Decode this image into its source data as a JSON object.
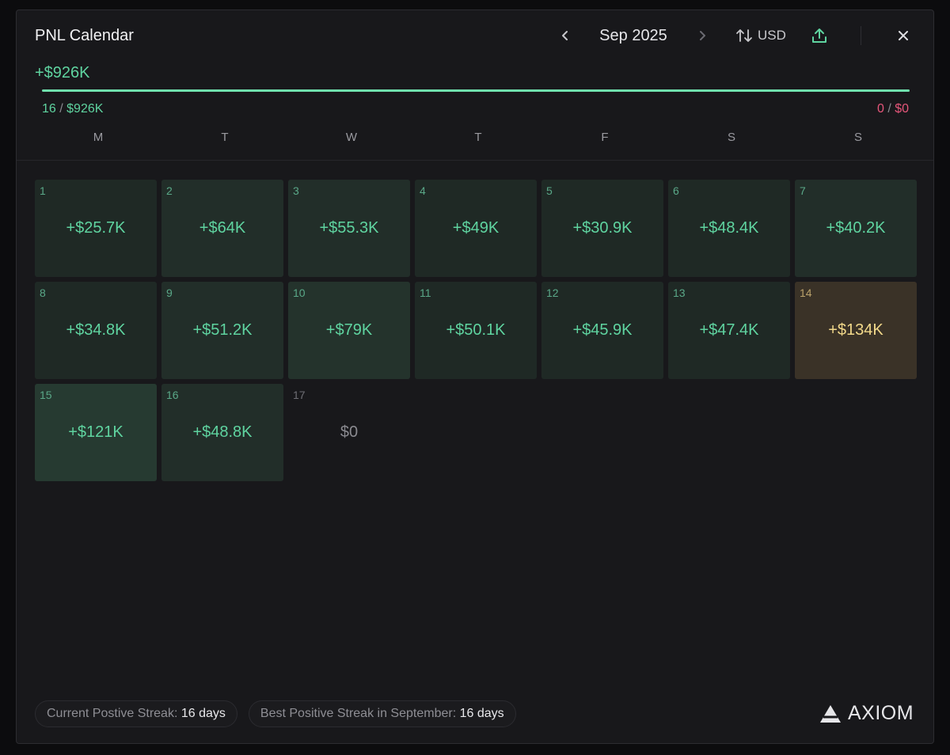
{
  "header": {
    "title": "PNL Calendar",
    "month": "Sep 2025",
    "currency": "USD"
  },
  "summary": {
    "total": "+$926K",
    "positive_days": "16",
    "positive_total": "$926K",
    "negative_days": "0",
    "negative_total": "$0",
    "positive_fraction": 1.0
  },
  "weekdays": [
    "M",
    "T",
    "W",
    "T",
    "F",
    "S",
    "S"
  ],
  "days": [
    {
      "num": "1",
      "value": "+$25.7K",
      "kind": "positive",
      "intensity": 1
    },
    {
      "num": "2",
      "value": "+$64K",
      "kind": "positive",
      "intensity": 2
    },
    {
      "num": "3",
      "value": "+$55.3K",
      "kind": "positive",
      "intensity": 2
    },
    {
      "num": "4",
      "value": "+$49K",
      "kind": "positive",
      "intensity": 1
    },
    {
      "num": "5",
      "value": "+$30.9K",
      "kind": "positive",
      "intensity": 1
    },
    {
      "num": "6",
      "value": "+$48.4K",
      "kind": "positive",
      "intensity": 1
    },
    {
      "num": "7",
      "value": "+$40.2K",
      "kind": "positive",
      "intensity": 2
    },
    {
      "num": "8",
      "value": "+$34.8K",
      "kind": "positive",
      "intensity": 1
    },
    {
      "num": "9",
      "value": "+$51.2K",
      "kind": "positive",
      "intensity": 2
    },
    {
      "num": "10",
      "value": "+$79K",
      "kind": "positive",
      "intensity": 3
    },
    {
      "num": "11",
      "value": "+$50.1K",
      "kind": "positive",
      "intensity": 1
    },
    {
      "num": "12",
      "value": "+$45.9K",
      "kind": "positive",
      "intensity": 1
    },
    {
      "num": "13",
      "value": "+$47.4K",
      "kind": "positive",
      "intensity": 1
    },
    {
      "num": "14",
      "value": "+$134K",
      "kind": "best",
      "intensity": 4
    },
    {
      "num": "15",
      "value": "+$121K",
      "kind": "positive",
      "intensity": 4
    },
    {
      "num": "16",
      "value": "+$48.8K",
      "kind": "positive",
      "intensity": 2
    },
    {
      "num": "17",
      "value": "$0",
      "kind": "zero",
      "intensity": 0
    }
  ],
  "footer": {
    "current_streak_label": "Current Postive Streak:",
    "current_streak_value": "16 days",
    "best_streak_label": "Best Positive Streak in September:",
    "best_streak_value": "16 days",
    "brand": "AXIOM"
  },
  "colors": {
    "positive_text": "#5fd4a0",
    "negative_text": "#e5567a",
    "best_text": "#f2d98a",
    "best_bg": "#3a3227",
    "zero_text": "#8a8a90",
    "green_bg_1": "#1f2925",
    "green_bg_2": "#222e29",
    "green_bg_3": "#24332c",
    "green_bg_4": "#263a31"
  },
  "icons": {
    "prev": "chevron-left-icon",
    "next": "chevron-right-icon",
    "currency": "sort-arrows-icon",
    "share": "upload-icon",
    "close": "close-icon",
    "logo": "axiom-triangle-icon"
  }
}
